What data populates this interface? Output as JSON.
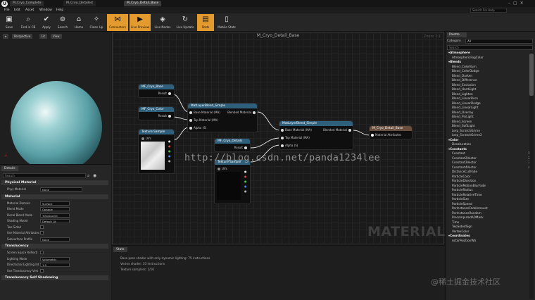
{
  "window": {
    "tabs": [
      "M_Cryo_Complete",
      "M_Cryo_Detailed",
      "M_Cryo_Detail_Base"
    ],
    "menu": [
      "File",
      "Edit",
      "Asset",
      "Window",
      "Help"
    ],
    "search_placeholder": "Search For Help"
  },
  "toolbar": {
    "buttons": [
      {
        "label": "Save",
        "icon": "floppy-icon",
        "active": false
      },
      {
        "label": "Find in CB",
        "icon": "magnify-icon",
        "active": false
      },
      {
        "label": "Apply",
        "icon": "check-icon",
        "active": false
      },
      {
        "label": "Search",
        "icon": "binoculars-icon",
        "active": false
      },
      {
        "label": "Home",
        "icon": "home-icon",
        "active": false
      },
      {
        "label": "Clean Up",
        "icon": "broom-icon",
        "active": false
      },
      {
        "label": "Connectors",
        "icon": "connector-icon",
        "active": true
      },
      {
        "label": "Live Preview",
        "icon": "live-preview-icon",
        "active": true
      },
      {
        "label": "Live Nodes",
        "icon": "live-nodes-icon",
        "active": false
      },
      {
        "label": "Live Update",
        "icon": "live-update-icon",
        "active": false
      },
      {
        "label": "Stats",
        "icon": "stats-icon",
        "active": true
      },
      {
        "label": "Mobile Stats",
        "icon": "mobile-stats-icon",
        "active": false
      }
    ]
  },
  "viewport": {
    "perspective": "Perspective",
    "lit": "Lit",
    "view": "View"
  },
  "details": {
    "tab": "Details",
    "search_placeholder": "Search",
    "sections": [
      {
        "title": "Physical Material",
        "rows": [
          {
            "label": "Phys Material",
            "value": "None",
            "kind": "select"
          }
        ]
      },
      {
        "title": "Material",
        "rows": [
          {
            "label": "Material Domain",
            "value": "Surface",
            "kind": "select"
          },
          {
            "label": "Blend Mode",
            "value": "Opaque",
            "kind": "select"
          },
          {
            "label": "Decal Blend Mode",
            "value": "Translucent",
            "kind": "select"
          },
          {
            "label": "Shading Model",
            "value": "Default Lit",
            "kind": "select"
          },
          {
            "label": "Two Sided",
            "value": "",
            "kind": "check"
          },
          {
            "label": "Use Material Attributes",
            "value": "",
            "kind": "check"
          },
          {
            "label": "Subsurface Profile",
            "value": "None",
            "kind": "select"
          }
        ]
      },
      {
        "title": "Translucency",
        "rows": [
          {
            "label": "Screen Space Reflecti",
            "value": "",
            "kind": "check"
          },
          {
            "label": "Lighting Mode",
            "value": "Volumetric NonDirectional",
            "kind": "select"
          },
          {
            "label": "Directional Lighting Int",
            "value": "1.0",
            "kind": "select"
          },
          {
            "label": "Use Translucency Vert",
            "value": "",
            "kind": "check"
          }
        ]
      },
      {
        "title": "Translucency Self Shadowing",
        "rows": []
      }
    ]
  },
  "graph": {
    "title": "M_Cryo_Detail_Base",
    "zoom": "Zoom 1:1",
    "watermark": "MATERIAL"
  },
  "nodes": {
    "mf_base": {
      "title": "MF_Cryo_Base",
      "pin": "Result"
    },
    "mf_color": {
      "title": "MF_Cryo_Color",
      "pin": "Result"
    },
    "texsample1": {
      "title": "Texture Sample",
      "pin": "UVs"
    },
    "blend1": {
      "title": "MatLayerBlend_Simple",
      "inputs": [
        "Base Material (MA)",
        "Top Material (MA)",
        "Alpha (S)"
      ],
      "output": "Blended Material"
    },
    "mf_details": {
      "title": "MF_Cryo_Details",
      "pin": "Result"
    },
    "texsample2": {
      "title": "Texture Sample",
      "pin": "UVs"
    },
    "blend2": {
      "title": "MatLayerBlend_Simple",
      "inputs": [
        "Base Material (MA)",
        "Top Material (MA)",
        "Alpha (S)"
      ],
      "output": "Blended Material"
    },
    "result": {
      "title": "M_Cryo_Detail_Base",
      "pin": "Material Attributes"
    }
  },
  "stats": {
    "tab": "Stats",
    "lines": [
      "Base pass shader with only dynamic lighting: 75 instructions",
      "Vertex shader: 33 instructions",
      "Texture samplers: 1/16"
    ]
  },
  "palette": {
    "tab": "Palette",
    "category_label": "Category",
    "category_value": "All",
    "search_placeholder": "Search",
    "items": [
      {
        "t": "Atmosphere",
        "cat": true
      },
      {
        "t": "AtmosphericFogColor"
      },
      {
        "t": "Blends",
        "cat": true
      },
      {
        "t": "Blend_ColorBurn"
      },
      {
        "t": "Blend_ColorDodge"
      },
      {
        "t": "Blend_Darken"
      },
      {
        "t": "Blend_Difference"
      },
      {
        "t": "Blend_Exclusion"
      },
      {
        "t": "Blend_HardLight"
      },
      {
        "t": "Blend_Lighten"
      },
      {
        "t": "Blend_LinearBurn"
      },
      {
        "t": "Blend_LinearDodge"
      },
      {
        "t": "Blend_LinearLight"
      },
      {
        "t": "Blend_Overlay"
      },
      {
        "t": "Blend_PinLight"
      },
      {
        "t": "Blend_Screen"
      },
      {
        "t": "Blend_SoftLight"
      },
      {
        "t": "Lerp_ScratchGrime"
      },
      {
        "t": "Lerp_ScratchGrime2"
      },
      {
        "t": "Color",
        "cat": true
      },
      {
        "t": "Desaturation"
      },
      {
        "t": "Constants",
        "cat": true
      },
      {
        "t": "Constant",
        "n": "1"
      },
      {
        "t": "Constant2Vector",
        "n": "2"
      },
      {
        "t": "Constant3Vector",
        "n": "3"
      },
      {
        "t": "Constant4Vector",
        "n": "4"
      },
      {
        "t": "DistanceCullFade"
      },
      {
        "t": "ParticleColor"
      },
      {
        "t": "ParticleDirection"
      },
      {
        "t": "ParticleMotionBlurFade"
      },
      {
        "t": "ParticleRadius"
      },
      {
        "t": "ParticleRelativeTime"
      },
      {
        "t": "ParticleSize"
      },
      {
        "t": "ParticleSpeed"
      },
      {
        "t": "PerInstanceFadeAmount"
      },
      {
        "t": "PerInstanceRandom"
      },
      {
        "t": "PrecomputedAOMask"
      },
      {
        "t": "Time"
      },
      {
        "t": "TwoSidedSign"
      },
      {
        "t": "VertexColor"
      },
      {
        "t": "Coordinates",
        "cat": true
      },
      {
        "t": "ActorPositionWS"
      }
    ]
  },
  "overlay": {
    "url": "http://blog.csdn.net/panda1234lee",
    "juejin": "@稀土掘金技术社区"
  }
}
